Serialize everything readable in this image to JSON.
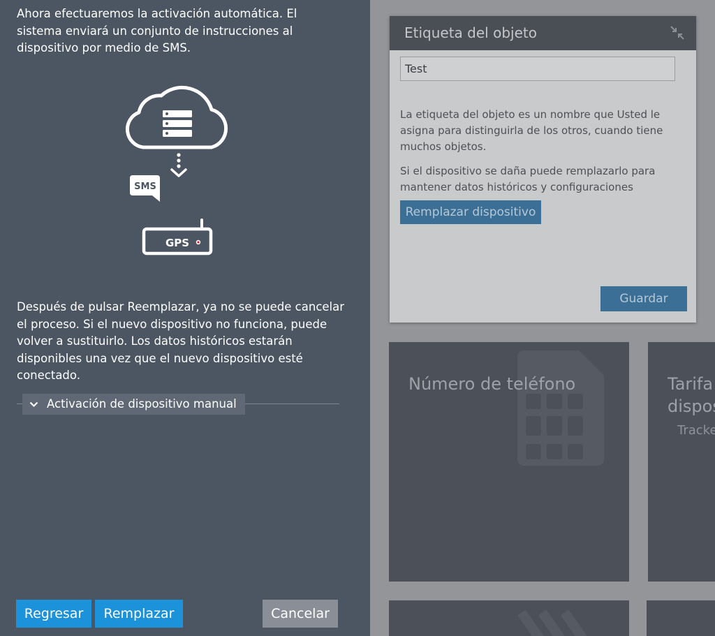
{
  "panel": {
    "intro_text": "Ahora efectuaremos la activación automática. El sistema enviará un conjunto de instrucciones al dispositivo por medio de SMS.",
    "illustration": {
      "sms_label": "SMS",
      "gps_label": "GPS",
      "icons": [
        "cloud-server-icon",
        "download-arrow-icon",
        "sms-bubble-icon",
        "gps-tracker-icon"
      ]
    },
    "warning_text": "Después de pulsar Reemplazar, ya no se puede cancelar el proceso. Si el nuevo dispositivo no funciona, puede volver a sustituirlo. Los datos históricos estarán disponibles una vez que el nuevo dispositivo esté conectado.",
    "manual_activation_label": "Activación de dispositivo manual",
    "buttons": {
      "back": "Regresar",
      "replace": "Remplazar",
      "cancel": "Cancelar"
    }
  },
  "background": {
    "object_label_card": {
      "title": "Etiqueta del objeto",
      "input_value": "Test",
      "help_text_1": "La etiqueta del objeto es un nombre que Usted le asigna para distinguirla de los otros, cuando tiene muchos objetos.",
      "help_text_2": "Si el dispositivo se daña puede remplazarlo para mantener datos históricos y configuraciones",
      "replace_device_button": "Remplazar dispositivo",
      "save_button": "Guardar"
    },
    "tiles": {
      "phone_number_title": "Número de teléfono",
      "tariff_title": "Tarifa",
      "tariff_title_line2": "dispos",
      "tariff_subtitle": "Tracke"
    }
  },
  "colors": {
    "panel_bg": "#4c5562",
    "primary_button": "#1b92da",
    "secondary_button": "#8a8e96",
    "card_header": "#4a4e55"
  }
}
